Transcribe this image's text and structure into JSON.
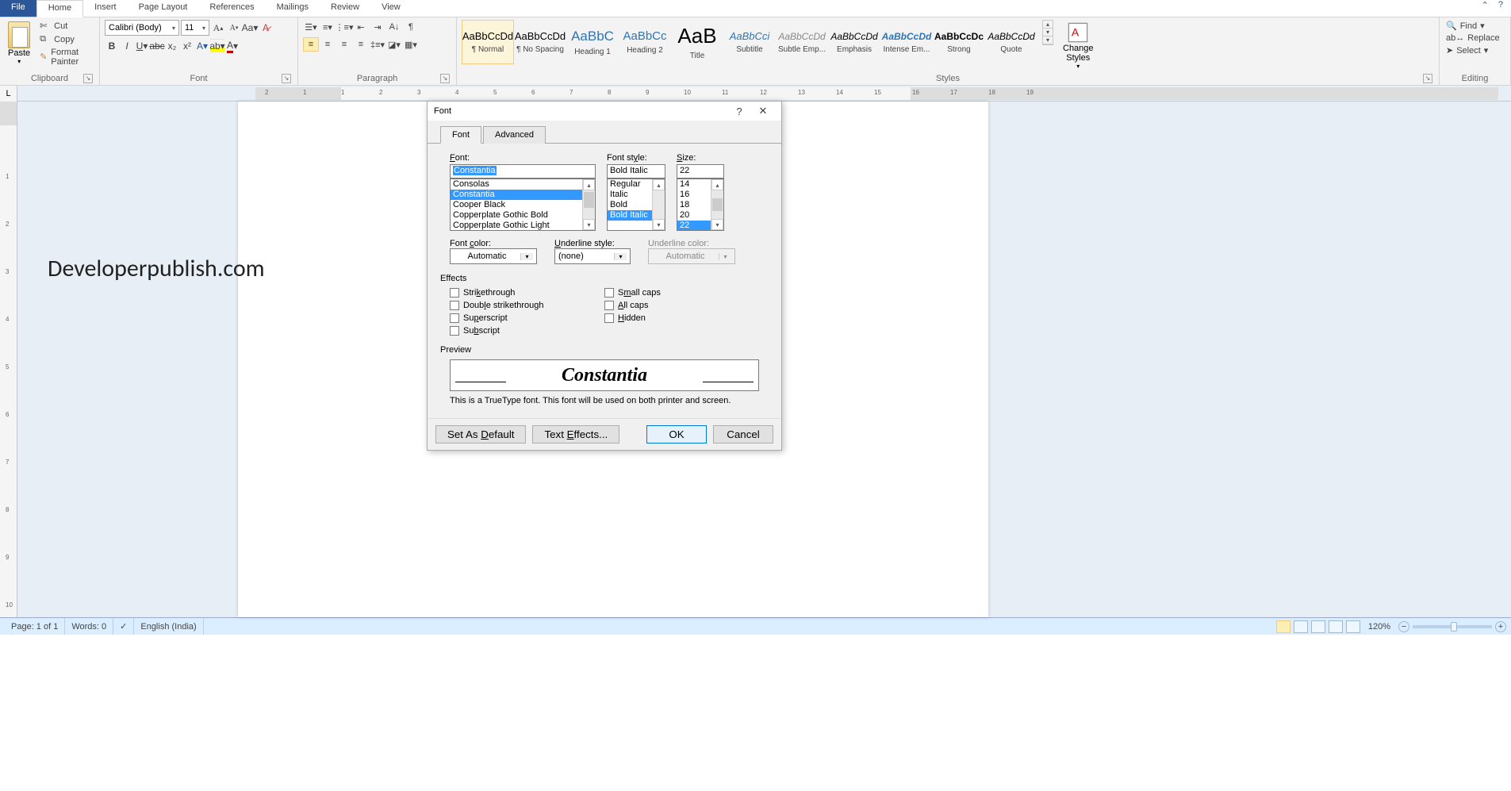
{
  "tabs": {
    "file": "File",
    "home": "Home",
    "insert": "Insert",
    "pagelayout": "Page Layout",
    "references": "References",
    "mailings": "Mailings",
    "review": "Review",
    "view": "View"
  },
  "clipboard": {
    "paste": "Paste",
    "cut": "Cut",
    "copy": "Copy",
    "painter": "Format Painter",
    "label": "Clipboard"
  },
  "font": {
    "name": "Calibri (Body)",
    "size": "11",
    "label": "Font"
  },
  "paragraph": {
    "label": "Paragraph"
  },
  "styles": {
    "label": "Styles",
    "items": [
      {
        "prev": "AaBbCcDd",
        "name": "¶ Normal",
        "sty": "font-size:13px;"
      },
      {
        "prev": "AaBbCcDd",
        "name": "¶ No Spacing",
        "sty": "font-size:13px;"
      },
      {
        "prev": "AaBbC",
        "name": "Heading 1",
        "sty": "font-size:17px;color:#2e74b5;"
      },
      {
        "prev": "AaBbCc",
        "name": "Heading 2",
        "sty": "font-size:15px;color:#2e74b5;"
      },
      {
        "prev": "AaB",
        "name": "Title",
        "sty": "font-size:26px;"
      },
      {
        "prev": "AaBbCci",
        "name": "Subtitle",
        "sty": "font-size:13px;color:#2e74b5;font-style:italic;"
      },
      {
        "prev": "AaBbCcDd",
        "name": "Subtle Emp...",
        "sty": "font-size:12px;color:#888;font-style:italic;"
      },
      {
        "prev": "AaBbCcDd",
        "name": "Emphasis",
        "sty": "font-size:12px;font-style:italic;"
      },
      {
        "prev": "AaBbCcDd",
        "name": "Intense Em...",
        "sty": "font-size:12px;color:#2e74b5;font-style:italic;font-weight:bold;"
      },
      {
        "prev": "AaBbCcDc",
        "name": "Strong",
        "sty": "font-size:12px;font-weight:bold;"
      },
      {
        "prev": "AaBbCcDd",
        "name": "Quote",
        "sty": "font-size:12px;font-style:italic;"
      }
    ],
    "change": "Change\nStyles"
  },
  "editing": {
    "find": "Find",
    "replace": "Replace",
    "select": "Select",
    "label": "Editing"
  },
  "document": {
    "text": "Developerpublish.com"
  },
  "status": {
    "page": "Page: 1 of 1",
    "words": "Words: 0",
    "lang": "English (India)",
    "zoom": "120%"
  },
  "dialog": {
    "title": "Font",
    "tab_font": "Font",
    "tab_advanced": "Advanced",
    "font_label": "Font:",
    "style_label": "Font style:",
    "size_label": "Size:",
    "font_value": "Constantia",
    "font_list": [
      "Consolas",
      "Constantia",
      "Cooper Black",
      "Copperplate Gothic Bold",
      "Copperplate Gothic Light"
    ],
    "font_selected": "Constantia",
    "style_value": "Bold Italic",
    "style_list": [
      "Regular",
      "Italic",
      "Bold",
      "Bold Italic"
    ],
    "style_selected": "Bold Italic",
    "size_value": "22",
    "size_list": [
      "14",
      "16",
      "18",
      "20",
      "22"
    ],
    "size_selected": "22",
    "color_label": "Font color:",
    "color_value": "Automatic",
    "under_label": "Underline style:",
    "under_value": "(none)",
    "undercolor_label": "Underline color:",
    "undercolor_value": "Automatic",
    "effects_label": "Effects",
    "fx": {
      "strike": "Strikethrough",
      "dstrike": "Double strikethrough",
      "super": "Superscript",
      "sub": "Subscript",
      "smallcaps": "Small caps",
      "allcaps": "All caps",
      "hidden": "Hidden"
    },
    "preview_label": "Preview",
    "preview_text": "Constantia",
    "preview_note": "This is a TrueType font. This font will be used on both printer and screen.",
    "set_default": "Set As Default",
    "text_effects": "Text Effects...",
    "ok": "OK",
    "cancel": "Cancel"
  }
}
